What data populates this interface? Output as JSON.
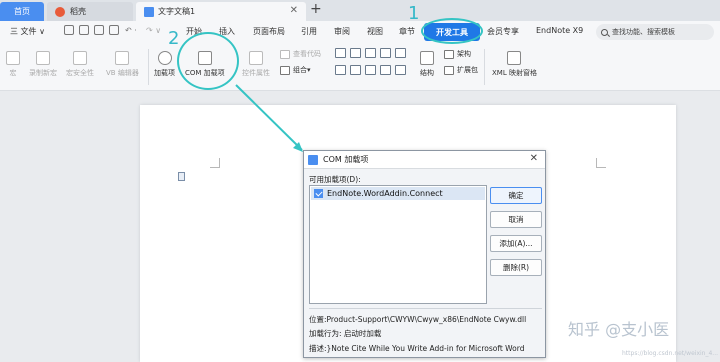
{
  "tabs": {
    "home": "首页",
    "daoke": "稻壳",
    "doc": "文字文稿1",
    "new_tab": "+"
  },
  "menu": {
    "file": "三 文件 ∨",
    "items": [
      "开始",
      "插入",
      "页面布局",
      "引用",
      "审阅",
      "视图",
      "章节",
      "开发工具",
      "会员专享",
      "EndNote X9"
    ],
    "search_placeholder": "查找功能、搜索模板"
  },
  "ribbon": {
    "macro": "宏",
    "record_macro": "录制新宏",
    "macro_security": "宏安全性",
    "vb_editor": "VB 编辑器",
    "addins": "加载项",
    "com_addins": "COM 加载项",
    "control_props": "控件属性",
    "view_code": "查看代码",
    "group": "组合",
    "structure": "结构",
    "schema": "架构",
    "expansion_pack": "扩展包",
    "xml_mapping": "XML 映射窗格"
  },
  "annotations": {
    "step1": "1",
    "step2": "2"
  },
  "dialog": {
    "title": "COM 加载项",
    "available_label": "可用加载项(D):",
    "items": [
      "EndNote.WordAddin.Connect"
    ],
    "buttons": {
      "ok": "确定",
      "cancel": "取消",
      "add": "添加(A)...",
      "remove": "删除(R)"
    },
    "location": "位置:Product-Support\\CWYW\\Cwyw_x86\\EndNote Cwyw.dll",
    "load_behavior": "加载行为: 启动时加载",
    "description": "描述:}Note Cite While You Write Add-in for Microsoft Word"
  },
  "watermark": {
    "text": "知乎 @支小医",
    "url": "https://blog.csdn.net/weixin_4..."
  },
  "colors": {
    "accent": "#1f78e6",
    "annotation": "#35c4c4"
  }
}
